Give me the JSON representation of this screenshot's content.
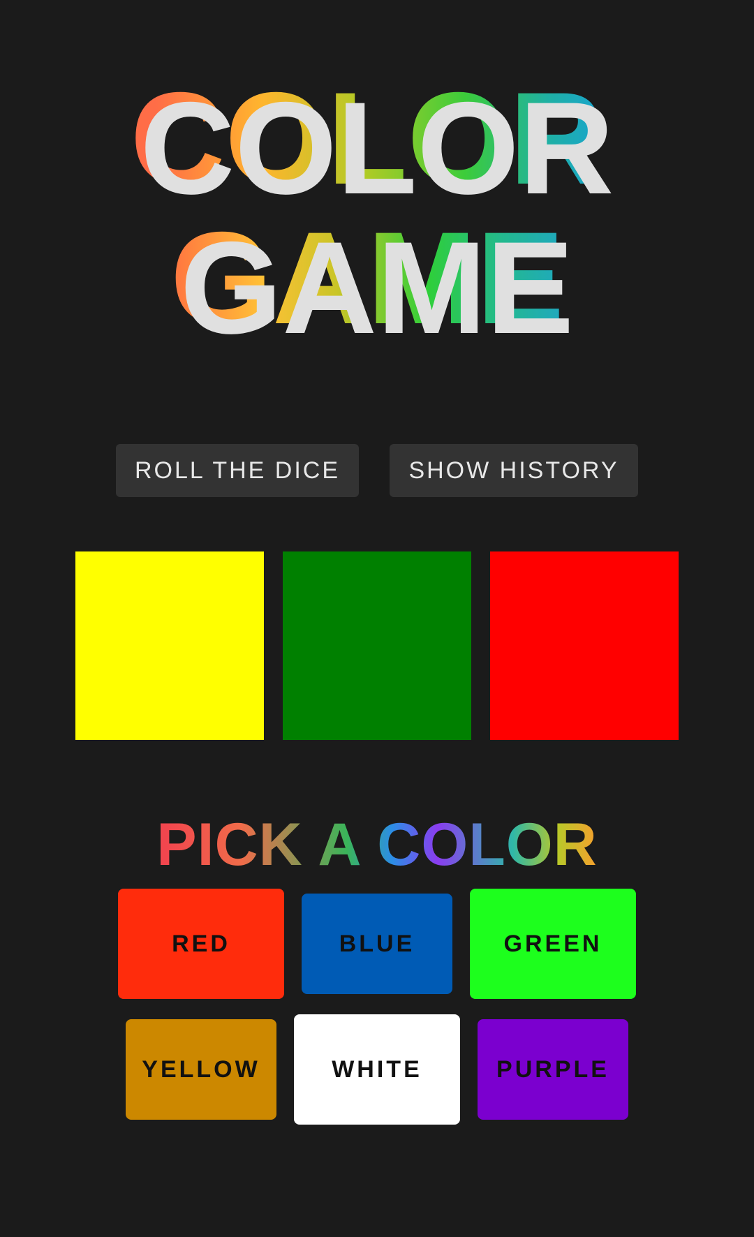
{
  "title": {
    "line1": "COLOR",
    "line2": "GAME"
  },
  "actions": {
    "roll_label": "ROLL THE DICE",
    "history_label": "SHOW HISTORY"
  },
  "dice": [
    {
      "color": "#ffff00"
    },
    {
      "color": "#008000"
    },
    {
      "color": "#ff0000"
    }
  ],
  "pick_heading": "PICK A COLOR",
  "choices": [
    {
      "label": "RED",
      "color": "#ff2c0c"
    },
    {
      "label": "BLUE",
      "color": "#005bb5"
    },
    {
      "label": "GREEN",
      "color": "#1dff1d"
    },
    {
      "label": "YELLOW",
      "color": "#cc8800"
    },
    {
      "label": "WHITE",
      "color": "#ffffff"
    },
    {
      "label": "PURPLE",
      "color": "#7b00cf"
    }
  ],
  "colors": {
    "background": "#1b1b1b",
    "button_bg": "#333333",
    "button_text": "#e8e8e8"
  }
}
